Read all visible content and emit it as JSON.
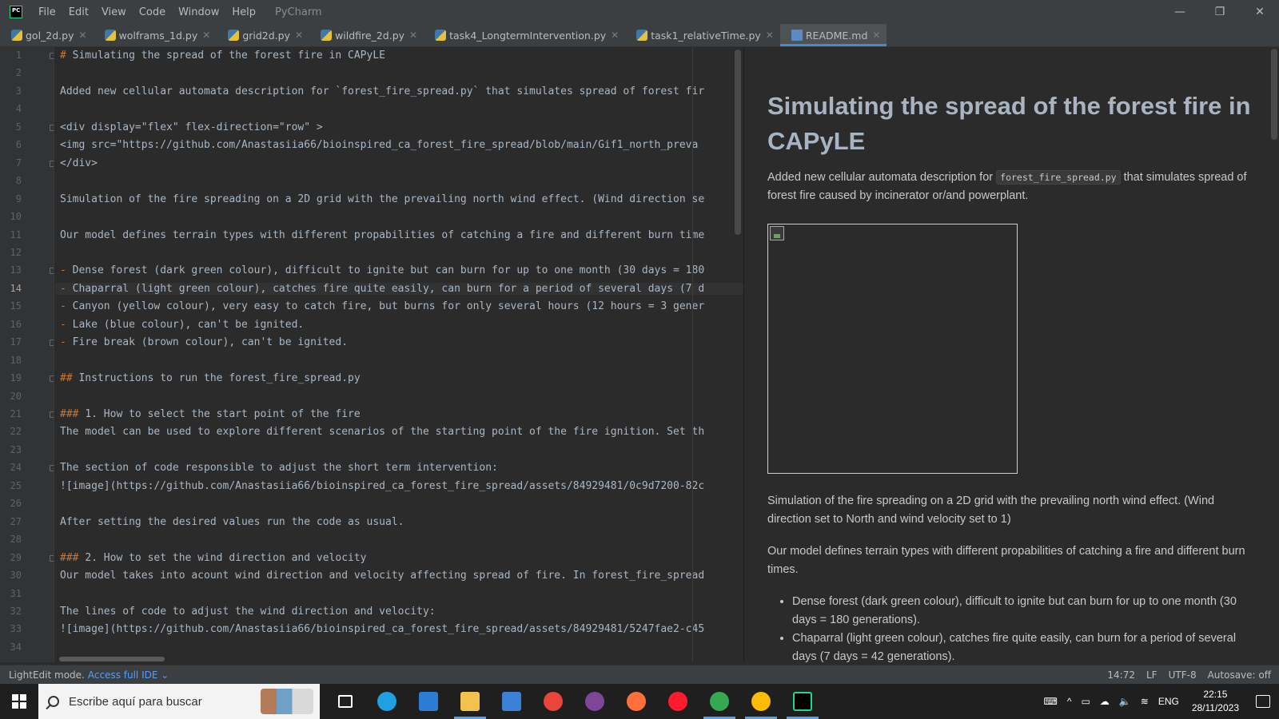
{
  "titlebar": {
    "menus": [
      "File",
      "Edit",
      "View",
      "Code",
      "Window",
      "Help"
    ],
    "app_name": "PyCharm",
    "minimize_glyph": "—",
    "restore_glyph": "❐",
    "close_glyph": "✕"
  },
  "tabs": [
    {
      "label": "gol_2d.py",
      "icon": "python-file-icon"
    },
    {
      "label": "wolframs_1d.py",
      "icon": "python-file-icon"
    },
    {
      "label": "grid2d.py",
      "icon": "python-file-icon"
    },
    {
      "label": "wildfire_2d.py",
      "icon": "python-file-icon"
    },
    {
      "label": "task4_LongtermIntervention.py",
      "icon": "python-file-icon"
    },
    {
      "label": "task1_relativeTime.py",
      "icon": "python-file-icon"
    },
    {
      "label": "README.md",
      "icon": "markdown-file-icon",
      "active": true
    }
  ],
  "editor": {
    "current_line": 14,
    "lines": [
      "# Simulating the spread of the forest fire in CAPyLE",
      "",
      "Added new cellular automata description for `forest_fire_spread.py` that simulates spread of forest fir",
      "",
      "<div display=\"flex\" flex-direction=\"row\" >",
      "<img src=\"https://github.com/Anastasiia66/bioinspired_ca_forest_fire_spread/blob/main/Gif1_north_preva",
      "</div>",
      "",
      "Simulation of the fire spreading on a 2D grid with the prevailing north wind effect. (Wind direction se",
      "",
      "Our model defines terrain types with different propabilities of catching a fire and different burn time",
      "",
      "- Dense forest (dark green colour), difficult to ignite but can burn for up to one month (30 days = 180",
      "- Chaparral (light green colour), catches fire quite easily, can burn for a period of several days (7 d",
      "- Canyon (yellow colour), very easy to catch fire, but burns for only several hours (12 hours = 3 gener",
      "- Lake (blue colour), can't be ignited.",
      "- Fire break (brown colour), can't be ignited.",
      "",
      "## Instructions to run the forest_fire_spread.py",
      "",
      "### 1. How to select the start point of the fire",
      "The model can be used to explore different scenarios of the starting point of the fire ignition. Set th",
      "",
      "The section of code responsible to adjust the short term intervention:",
      "![image](https://github.com/Anastasiia66/bioinspired_ca_forest_fire_spread/assets/84929481/0c9d7200-82c",
      "",
      "After setting the desired values run the code as usual.",
      "",
      "### 2. How to set the wind direction and velocity",
      "Our model takes into acount wind direction and velocity affecting spread of fire. In forest_fire_spread",
      "",
      "The lines of code to adjust the wind direction and velocity:",
      "![image](https://github.com/Anastasiia66/bioinspired_ca_forest_fire_spread/assets/84929481/5247fae2-c45",
      ""
    ]
  },
  "preview": {
    "title": "Simulating the spread of the forest fire in CAPyLE",
    "intro_before": "Added new cellular automata description for ",
    "intro_code": "forest_fire_spread.py",
    "intro_after": " that simulates spread of forest fire caused by incinerator or/and powerplant.",
    "para_wind": "Simulation of the fire spreading on a 2D grid with the prevailing north wind effect. (Wind direction set to North and wind velocity set to 1)",
    "para_terrain": "Our model defines terrain types with different propabilities of catching a fire and different burn times.",
    "list": [
      "Dense forest (dark green colour), difficult to ignite but can burn for up to one month (30 days = 180 generations).",
      "Chaparral (light green colour), catches fire quite easily, can burn for a period of several days (7 days = 42 generations)."
    ]
  },
  "statusbar": {
    "mode": "LightEdit mode.",
    "access": "Access full IDE",
    "caret": "14:72",
    "line_sep": "LF",
    "encoding": "UTF-8",
    "autosave": "Autosave: off"
  },
  "taskbar": {
    "search_placeholder": "Escribe aquí para buscar",
    "language": "ENG",
    "time": "22:15",
    "date": "28/11/2023",
    "apps": [
      {
        "name": "task-view-icon",
        "color": "#ffffff"
      },
      {
        "name": "edge-icon",
        "color": "#1fa0e0"
      },
      {
        "name": "mail-icon",
        "color": "#2b7cd3"
      },
      {
        "name": "file-explorer-icon",
        "color": "#f2c14e",
        "active": true
      },
      {
        "name": "app-installer-icon",
        "color": "#3b82d6"
      },
      {
        "name": "chrome-icon",
        "color": "#e8453c"
      },
      {
        "name": "tor-icon",
        "color": "#7d4698"
      },
      {
        "name": "firefox-icon",
        "color": "#ff7139"
      },
      {
        "name": "opera-icon",
        "color": "#ff1b2d"
      },
      {
        "name": "chrome-profile-icon",
        "color": "#34a853",
        "active": true
      },
      {
        "name": "chrome-profile-2-icon",
        "color": "#fbbc05",
        "active": true
      },
      {
        "name": "pycharm-icon",
        "color": "#21d789",
        "active": true
      }
    ]
  },
  "colors": {
    "accent": "#4a88c7",
    "link": "#589df6",
    "markdown_marker": "#cc7832"
  }
}
